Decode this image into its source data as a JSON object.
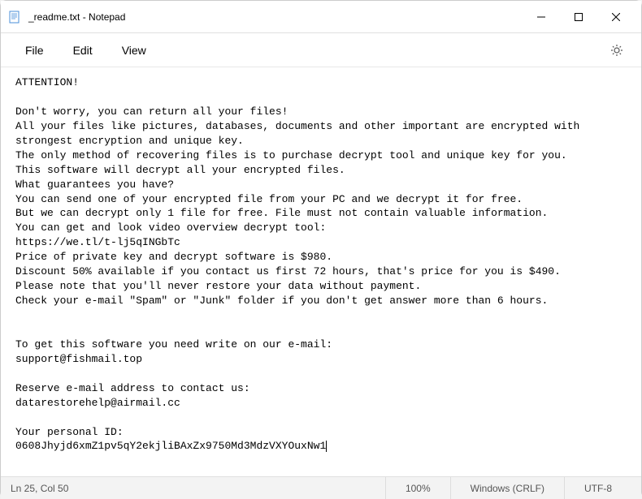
{
  "window": {
    "title": "_readme.txt - Notepad",
    "icon": "notepad-icon"
  },
  "menu": {
    "file": "File",
    "edit": "Edit",
    "view": "View"
  },
  "document": {
    "text": "ATTENTION!\n\nDon't worry, you can return all your files!\nAll your files like pictures, databases, documents and other important are encrypted with strongest encryption and unique key.\nThe only method of recovering files is to purchase decrypt tool and unique key for you.\nThis software will decrypt all your encrypted files.\nWhat guarantees you have?\nYou can send one of your encrypted file from your PC and we decrypt it for free.\nBut we can decrypt only 1 file for free. File must not contain valuable information.\nYou can get and look video overview decrypt tool:\nhttps://we.tl/t-lj5qINGbTc\nPrice of private key and decrypt software is $980.\nDiscount 50% available if you contact us first 72 hours, that's price for you is $490.\nPlease note that you'll never restore your data without payment.\nCheck your e-mail \"Spam\" or \"Junk\" folder if you don't get answer more than 6 hours.\n\n\nTo get this software you need write on our e-mail:\nsupport@fishmail.top\n\nReserve e-mail address to contact us:\ndatarestorehelp@airmail.cc\n\nYour personal ID:\n0608Jhyjd6xmZ1pv5qY2ekjliBAxZx9750Md3MdzVXYOuxNw1"
  },
  "status": {
    "position": "Ln 25, Col 50",
    "zoom": "100%",
    "lineending": "Windows (CRLF)",
    "encoding": "UTF-8"
  }
}
